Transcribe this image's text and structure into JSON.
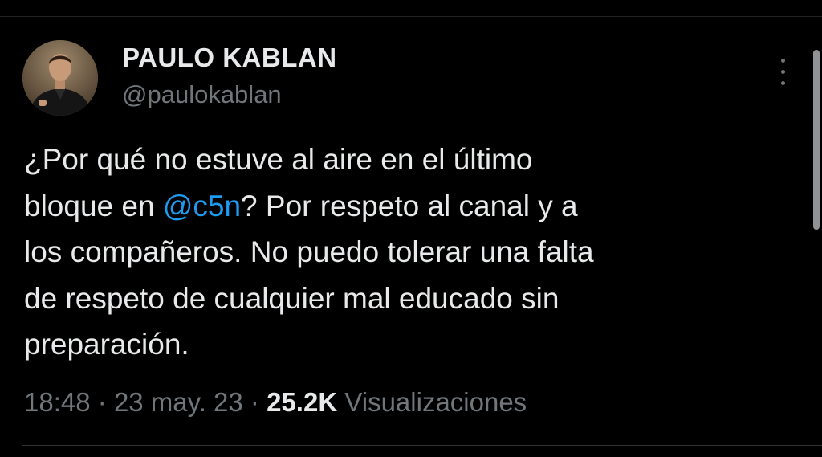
{
  "author": {
    "display_name": "PAULO KABLAN",
    "handle": "@paulokablan",
    "avatar_icon": "person-portrait"
  },
  "more_icon": "more-vertical-icon",
  "tweet": {
    "line1": "¿Por qué no estuve al aire en el último",
    "line2_before": "bloque en ",
    "mention": "@c5n",
    "line2_after": "? Por respeto al canal y a",
    "line3": "los compañeros. No puedo tolerar una falta",
    "line4": "de respeto de cualquier mal educado sin",
    "line5": "preparación."
  },
  "meta": {
    "time": "18:48",
    "separator": "·",
    "date": "23 may. 23",
    "views_count": "25.2K",
    "views_label": "Visualizaciones"
  },
  "colors": {
    "background": "#000000",
    "primary_text": "#e7e9ea",
    "secondary_text": "#71767b",
    "link": "#1d9bf0"
  }
}
